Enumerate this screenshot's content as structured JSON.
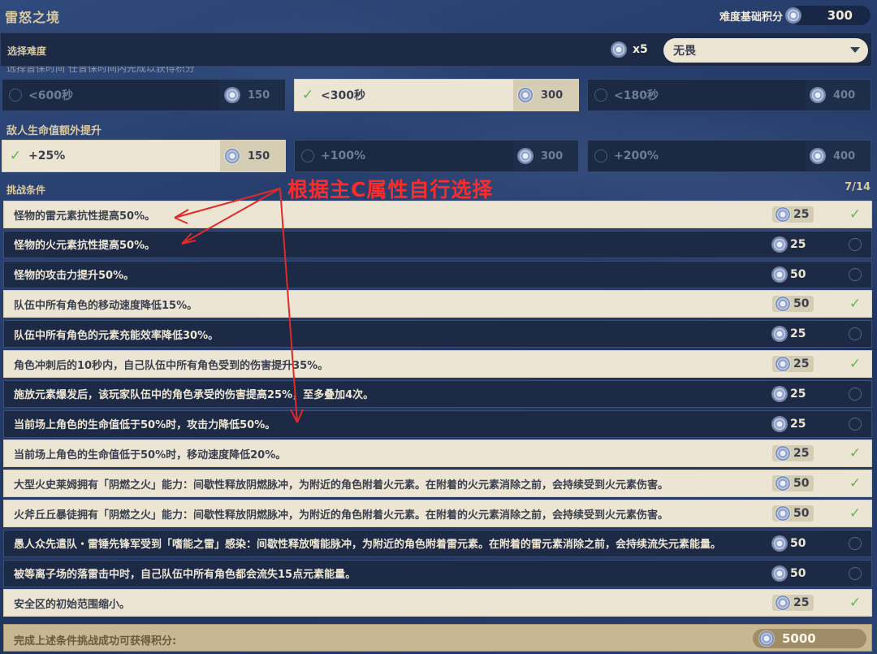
{
  "header": {
    "title": "雷怒之境",
    "score_label": "难度基础积分",
    "score_value": "300"
  },
  "difficulty": {
    "label": "选择难度",
    "multiplier": "x5",
    "selected": "无畏"
  },
  "time_options": {
    "cut_label": "选择曾保时间 任曾保时间内先成以获得积分",
    "items": [
      {
        "label": "<600秒",
        "points": "150",
        "selected": false
      },
      {
        "label": "<300秒",
        "points": "300",
        "selected": true
      },
      {
        "label": "<180秒",
        "points": "400",
        "selected": false
      }
    ]
  },
  "hp_options": {
    "label": "敌人生命值额外提升",
    "items": [
      {
        "label": "+25%",
        "points": "150",
        "selected": true
      },
      {
        "label": "+100%",
        "points": "300",
        "selected": false
      },
      {
        "label": "+200%",
        "points": "400",
        "selected": false
      }
    ]
  },
  "conditions": {
    "label": "挑战条件",
    "count": "7/14",
    "annotation": "根据主C属性自行选择",
    "items": [
      {
        "text": "怪物的雷元素抗性提高50%。",
        "points": "25",
        "selected": true
      },
      {
        "text": "怪物的火元素抗性提高50%。",
        "points": "25",
        "selected": false
      },
      {
        "text": "怪物的攻击力提升50%。",
        "points": "50",
        "selected": false
      },
      {
        "text": "队伍中所有角色的移动速度降低15%。",
        "points": "50",
        "selected": true
      },
      {
        "text": "队伍中所有角色的元素充能效率降低30%。",
        "points": "25",
        "selected": false
      },
      {
        "text": "角色冲刺后的10秒内，自己队伍中所有角色受到的伤害提升35%。",
        "points": "25",
        "selected": true
      },
      {
        "text": "施放元素爆发后，该玩家队伍中的角色承受的伤害提高25%，至多叠加4次。",
        "points": "25",
        "selected": false
      },
      {
        "text": "当前场上角色的生命值低于50%时，攻击力降低50%。",
        "points": "25",
        "selected": false
      },
      {
        "text": "当前场上角色的生命值低于50%时，移动速度降低20%。",
        "points": "25",
        "selected": true
      },
      {
        "text": "大型火史莱姆拥有「阴燃之火」能力：间歇性释放阴燃脉冲，为附近的角色附着火元素。在附着的火元素消除之前，会持续受到火元素伤害。",
        "points": "50",
        "selected": true
      },
      {
        "text": "火斧丘丘暴徒拥有「阴燃之火」能力：间歇性释放阴燃脉冲，为附近的角色附着火元素。在附着的火元素消除之前，会持续受到火元素伤害。",
        "points": "50",
        "selected": true
      },
      {
        "text": "愚人众先遣队・雷锤先锋军受到「嗜能之雷」感染：间歇性释放嗜能脉冲，为附近的角色附着雷元素。在附着的雷元素消除之前，会持续流失元素能量。",
        "points": "50",
        "selected": false
      },
      {
        "text": "被等离子场的落雷击中时，自己队伍中所有角色都会流失15点元素能量。",
        "points": "50",
        "selected": false
      },
      {
        "text": "安全区的初始范围缩小。",
        "points": "25",
        "selected": true
      }
    ]
  },
  "footer": {
    "label": "完成上述条件挑战成功可获得积分:",
    "value": "5000"
  },
  "colors": {
    "selected_bg": "#ece5d3",
    "unselected_bg": "#1c2a45",
    "check": "#5fb84a",
    "annotation": "#ff2a2a"
  }
}
